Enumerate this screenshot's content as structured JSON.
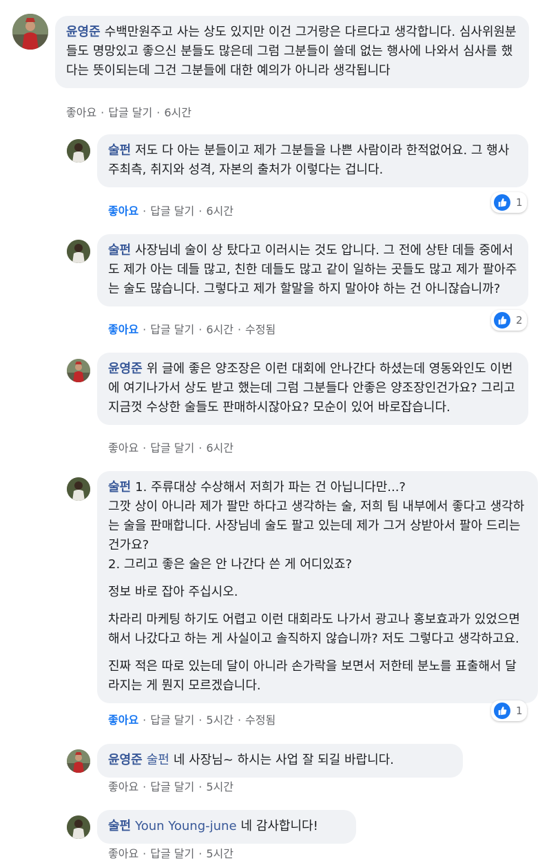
{
  "comments": [
    {
      "author": "윤영준",
      "lines": [
        "수백만원주고 사는 상도 있지만 이건 그거랑은 다르다고 생각합니다. 심사위원분들도 명망있고 좋으신 분들도 많은데 그럼 그분들이 쓸데 없는 행사에 나와서 심사를 했다는 뜻이되는데 그건 그분들에 대한 예의가 아니라 생각됩니다"
      ],
      "like_label": "좋아요",
      "reply_label": "답글 달기",
      "time": "6시간"
    },
    {
      "author": "술펀",
      "lines": [
        "저도 다 아는 분들이고 제가 그분들을 나쁜 사람이라 한적없어요. 그 행사 주최측, 취지와 성격, 자본의 출처가 이렇다는 겁니다."
      ],
      "like_label": "좋아요",
      "reply_label": "답글 달기",
      "time": "6시간",
      "reaction_count": "1"
    },
    {
      "author": "술펀",
      "lines": [
        "사장님네 술이 상 탔다고 이러시는 것도 압니다. 그 전에 상탄 데들 중에서도 제가 아는 데들 많고, 친한 데들도 많고 같이 일하는 곳들도 많고 제가 팔아주는 술도 많습니다. 그렇다고 제가 할말을 하지 말아야 하는 건 아니잖습니까?"
      ],
      "like_label": "좋아요",
      "reply_label": "답글 달기",
      "time": "6시간",
      "edited": "수정됨",
      "reaction_count": "2"
    },
    {
      "author": "윤영준",
      "lines": [
        "위 글에 좋은 양조장은 이런 대회에 안나간다 하셨는데 영동와인도 이번에 여기나가서 상도 받고 했는데 그럼 그분들다 안좋은 양조장인건가요? 그리고 지금껏 수상한 술들도 판매하시잖아요? 모순이 있어 바로잡습니다."
      ],
      "like_label": "좋아요",
      "reply_label": "답글 달기",
      "time": "6시간"
    },
    {
      "author": "술펀",
      "lines": [
        "1. 주류대상 수상해서 저희가 파는 건 아닙니다만...?\n그깟 상이 아니라 제가 팔만 하다고 생각하는 술, 저희 팀 내부에서 좋다고 생각하는 술을 판매합니다. 사장님네 술도 팔고 있는데 제가 그거 상받아서 팔아 드리는 건가요?\n2. 그리고 좋은 술은 안 나간다 쓴 게 어디있죠?",
        "정보 바로 잡아 주십시오.",
        "차라리 마케팅 하기도 어렵고 이런 대회라도 나가서 광고나 홍보효과가 있었으면 해서 나갔다고 하는 게 사실이고 솔직하지 않습니까? 저도 그렇다고 생각하고요.",
        "진짜 적은 따로 있는데 달이 아니라 손가락을 보면서 저한테 분노를 표출해서 달라지는 게 뭔지 모르겠습니다."
      ],
      "like_label": "좋아요",
      "reply_label": "답글 달기",
      "time": "5시간",
      "edited": "수정됨",
      "reaction_count": "1"
    },
    {
      "author": "윤영준",
      "mention": "술펀",
      "lines": [
        "네 사장님~ 하시는 사업 잘 되길 바랍니다."
      ],
      "like_label": "좋아요",
      "reply_label": "답글 달기",
      "time": "5시간"
    },
    {
      "author": "술펀",
      "mention": "Youn Young-june",
      "lines": [
        "네 감사합니다!"
      ],
      "like_label": "좋아요",
      "reply_label": "답글 달기",
      "time": "5시간"
    }
  ],
  "colors": {
    "bubble_bg": "#f0f2f5",
    "author": "#385898",
    "meta": "#65676b",
    "like_active": "#1877f2"
  },
  "icons": [
    "like-icon"
  ]
}
